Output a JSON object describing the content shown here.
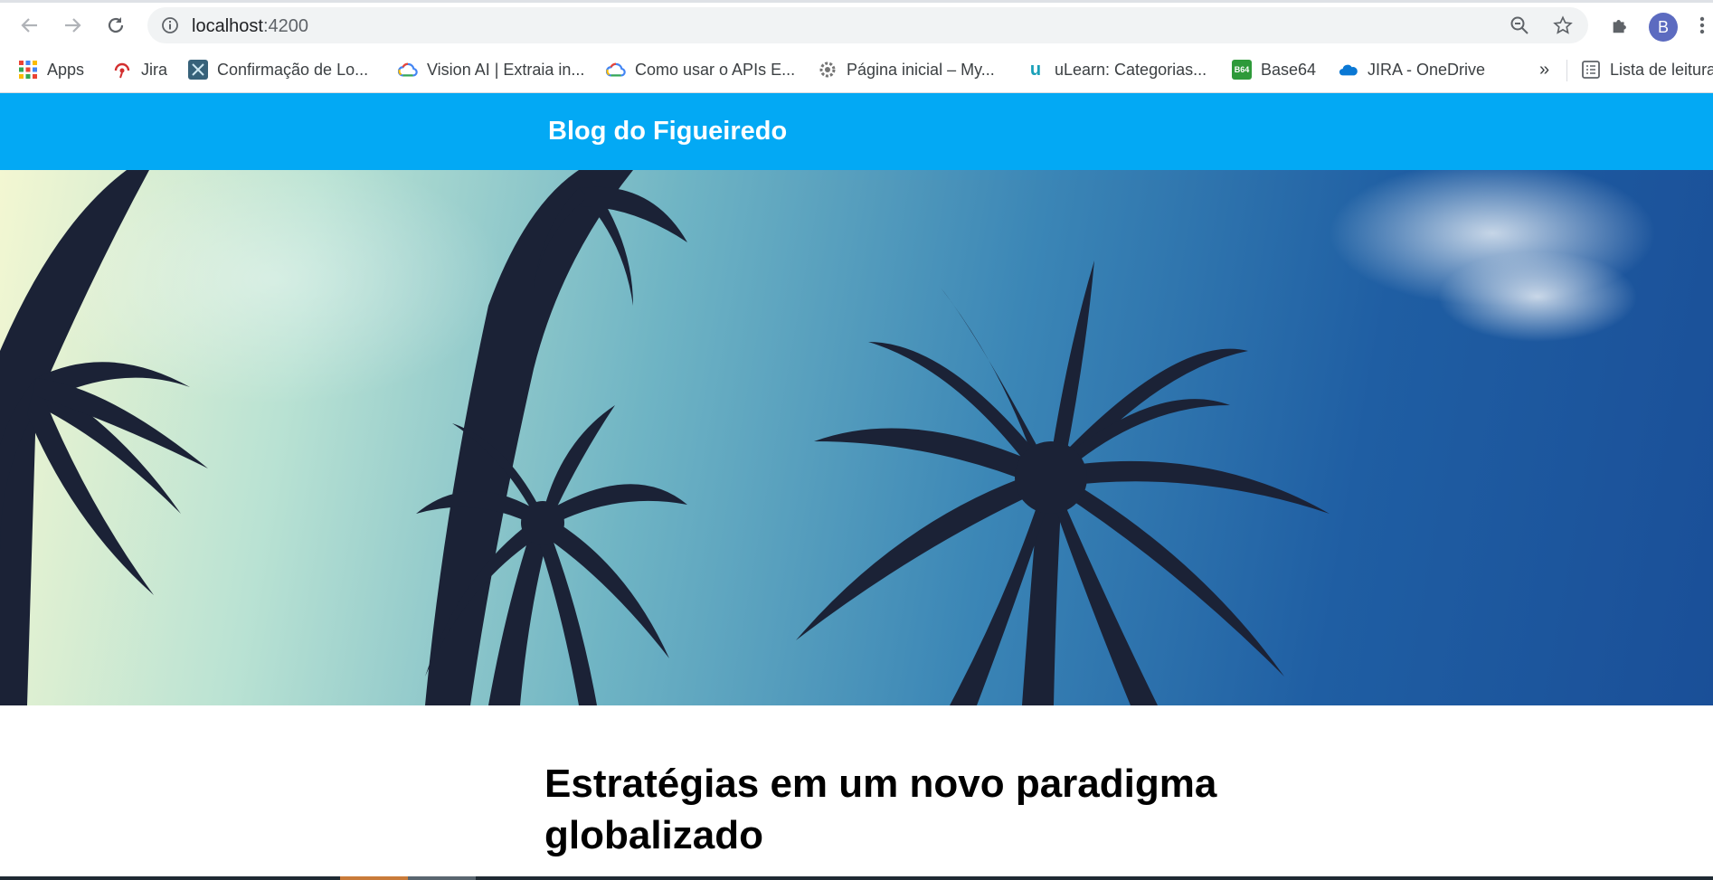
{
  "browser": {
    "url_host": "localhost",
    "url_port": ":4200",
    "profile_initial": "B",
    "overflow_chevron": "»",
    "bookmarks": [
      {
        "label": "Apps",
        "icon": "apps-grid-icon"
      },
      {
        "label": "Jira",
        "icon": "jira-icon"
      },
      {
        "label": "Confirmação de Lo...",
        "icon": "tool-icon"
      },
      {
        "label": "Vision AI | Extraia in...",
        "icon": "google-cloud-icon"
      },
      {
        "label": "Como usar o APIs E...",
        "icon": "google-cloud-icon"
      },
      {
        "label": "Página inicial – My...",
        "icon": "gear-icon"
      },
      {
        "label": "uLearn: Categorias...",
        "icon": "ulearn-icon"
      },
      {
        "label": "Base64",
        "icon": "base64-icon"
      },
      {
        "label": "JIRA - OneDrive",
        "icon": "onedrive-icon"
      }
    ],
    "reading_list_label": "Lista de leitura",
    "base64_badge": "B64",
    "ulearn_glyph": "u"
  },
  "page": {
    "header_title": "Blog do Figueiredo",
    "header_color": "#03a9f4",
    "post_title": "Estratégias em um novo paradigma globalizado"
  }
}
